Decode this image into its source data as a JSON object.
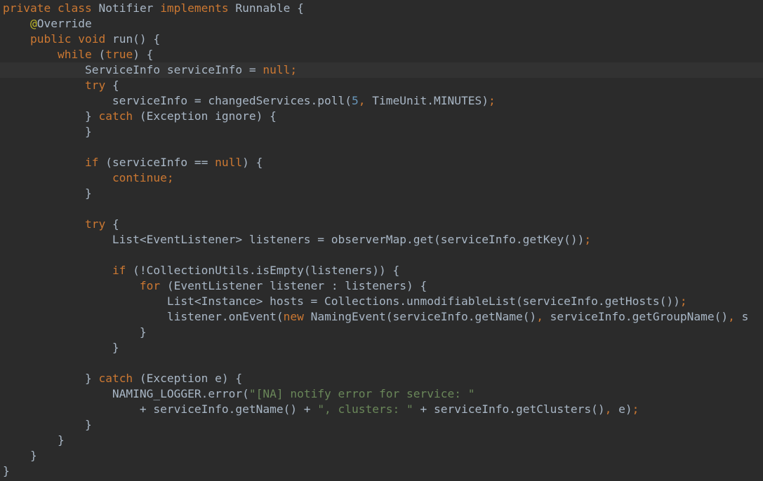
{
  "colors": {
    "background": "#2b2b2b",
    "current_line": "#323232",
    "plain": "#a9b7c6",
    "keyword": "#cc7832",
    "annotation": "#bbb529",
    "string": "#6a8759",
    "number": "#6897bb"
  },
  "current_line_index": 4,
  "lines": [
    [
      {
        "t": "kw",
        "s": "private"
      },
      {
        "t": "txt",
        "s": " "
      },
      {
        "t": "kw",
        "s": "class"
      },
      {
        "t": "txt",
        "s": " Notifier "
      },
      {
        "t": "kw",
        "s": "implements"
      },
      {
        "t": "txt",
        "s": " Runnable {"
      }
    ],
    [
      {
        "t": "txt",
        "s": "    "
      },
      {
        "t": "an",
        "s": "@"
      },
      {
        "t": "txt",
        "s": "Override"
      }
    ],
    [
      {
        "t": "txt",
        "s": "    "
      },
      {
        "t": "kw",
        "s": "public"
      },
      {
        "t": "txt",
        "s": " "
      },
      {
        "t": "kw",
        "s": "void"
      },
      {
        "t": "txt",
        "s": " run() {"
      }
    ],
    [
      {
        "t": "txt",
        "s": "        "
      },
      {
        "t": "kw",
        "s": "while"
      },
      {
        "t": "txt",
        "s": " ("
      },
      {
        "t": "kw",
        "s": "true"
      },
      {
        "t": "txt",
        "s": ") {"
      }
    ],
    [
      {
        "t": "txt",
        "s": "            ServiceInfo serviceInfo = "
      },
      {
        "t": "kw",
        "s": "null"
      },
      {
        "t": "kw",
        "s": ";"
      }
    ],
    [
      {
        "t": "txt",
        "s": "            "
      },
      {
        "t": "kw",
        "s": "try"
      },
      {
        "t": "txt",
        "s": " {"
      }
    ],
    [
      {
        "t": "txt",
        "s": "                serviceInfo = changedServices.poll("
      },
      {
        "t": "num",
        "s": "5"
      },
      {
        "t": "kw",
        "s": ","
      },
      {
        "t": "txt",
        "s": " TimeUnit."
      },
      {
        "t": "txt",
        "s": "MINUTES"
      },
      {
        "t": "txt",
        "s": ")"
      },
      {
        "t": "kw",
        "s": ";"
      }
    ],
    [
      {
        "t": "txt",
        "s": "            } "
      },
      {
        "t": "kw",
        "s": "catch"
      },
      {
        "t": "txt",
        "s": " (Exception ignore) {"
      }
    ],
    [
      {
        "t": "txt",
        "s": "            }"
      }
    ],
    [
      {
        "t": "txt",
        "s": ""
      }
    ],
    [
      {
        "t": "txt",
        "s": "            "
      },
      {
        "t": "kw",
        "s": "if"
      },
      {
        "t": "txt",
        "s": " (serviceInfo == "
      },
      {
        "t": "kw",
        "s": "null"
      },
      {
        "t": "txt",
        "s": ") {"
      }
    ],
    [
      {
        "t": "txt",
        "s": "                "
      },
      {
        "t": "kw",
        "s": "continue;"
      }
    ],
    [
      {
        "t": "txt",
        "s": "            }"
      }
    ],
    [
      {
        "t": "txt",
        "s": ""
      }
    ],
    [
      {
        "t": "txt",
        "s": "            "
      },
      {
        "t": "kw",
        "s": "try"
      },
      {
        "t": "txt",
        "s": " {"
      }
    ],
    [
      {
        "t": "txt",
        "s": "                List<EventListener> listeners = observerMap.get(serviceInfo.getKey())"
      },
      {
        "t": "kw",
        "s": ";"
      }
    ],
    [
      {
        "t": "txt",
        "s": ""
      }
    ],
    [
      {
        "t": "txt",
        "s": "                "
      },
      {
        "t": "kw",
        "s": "if"
      },
      {
        "t": "txt",
        "s": " (!CollectionUtils."
      },
      {
        "t": "txt",
        "s": "isEmpty"
      },
      {
        "t": "txt",
        "s": "(listeners)) {"
      }
    ],
    [
      {
        "t": "txt",
        "s": "                    "
      },
      {
        "t": "kw",
        "s": "for"
      },
      {
        "t": "txt",
        "s": " (EventListener listener : listeners) {"
      }
    ],
    [
      {
        "t": "txt",
        "s": "                        List<Instance> hosts = Collections."
      },
      {
        "t": "txt",
        "s": "unmodifiableList"
      },
      {
        "t": "txt",
        "s": "(serviceInfo.getHosts())"
      },
      {
        "t": "kw",
        "s": ";"
      }
    ],
    [
      {
        "t": "txt",
        "s": "                        listener.onEvent("
      },
      {
        "t": "kw",
        "s": "new"
      },
      {
        "t": "txt",
        "s": " NamingEvent(serviceInfo.getName()"
      },
      {
        "t": "kw",
        "s": ","
      },
      {
        "t": "txt",
        "s": " serviceInfo.getGroupName()"
      },
      {
        "t": "kw",
        "s": ","
      },
      {
        "t": "txt",
        "s": " s"
      }
    ],
    [
      {
        "t": "txt",
        "s": "                    }"
      }
    ],
    [
      {
        "t": "txt",
        "s": "                }"
      }
    ],
    [
      {
        "t": "txt",
        "s": ""
      }
    ],
    [
      {
        "t": "txt",
        "s": "            } "
      },
      {
        "t": "kw",
        "s": "catch"
      },
      {
        "t": "txt",
        "s": " (Exception e) {"
      }
    ],
    [
      {
        "t": "txt",
        "s": "                NAMING_LOGGER.error("
      },
      {
        "t": "str",
        "s": "\"[NA] notify error for service: \""
      }
    ],
    [
      {
        "t": "txt",
        "s": "                    + serviceInfo.getName() + "
      },
      {
        "t": "str",
        "s": "\", clusters: \""
      },
      {
        "t": "txt",
        "s": " + serviceInfo.getClusters()"
      },
      {
        "t": "kw",
        "s": ","
      },
      {
        "t": "txt",
        "s": " e)"
      },
      {
        "t": "kw",
        "s": ";"
      }
    ],
    [
      {
        "t": "txt",
        "s": "            }"
      }
    ],
    [
      {
        "t": "txt",
        "s": "        }"
      }
    ],
    [
      {
        "t": "txt",
        "s": "    }"
      }
    ],
    [
      {
        "t": "txt",
        "s": "}"
      }
    ]
  ]
}
